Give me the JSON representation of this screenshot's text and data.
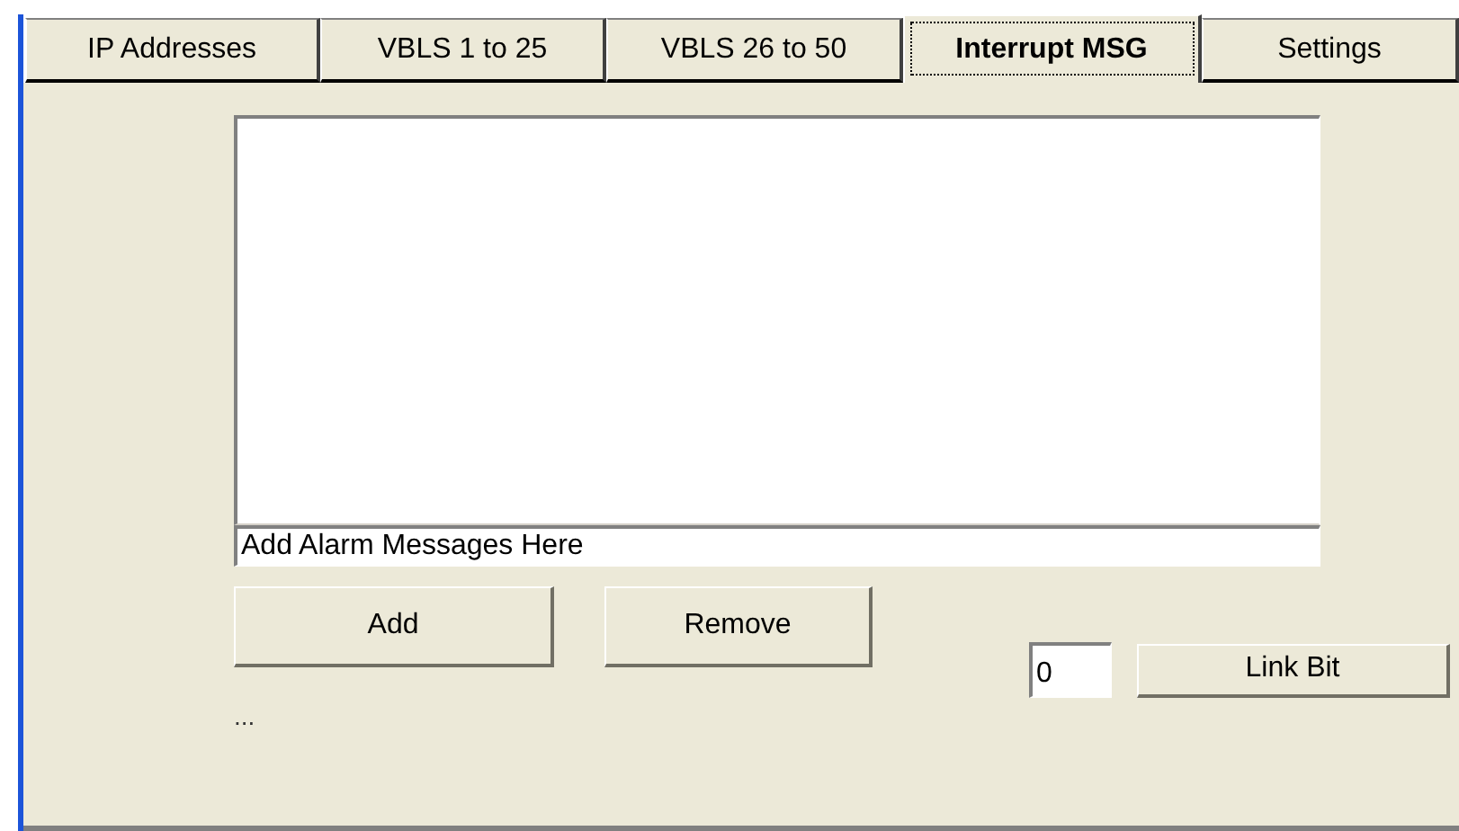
{
  "tabs": [
    {
      "label": "IP Addresses",
      "selected": false
    },
    {
      "label": "VBLS 1 to 25",
      "selected": false
    },
    {
      "label": "VBLS 26 to 50",
      "selected": false
    },
    {
      "label": "Interrupt MSG",
      "selected": true
    },
    {
      "label": "Settings",
      "selected": false
    }
  ],
  "message_field": {
    "value": "Add Alarm Messages Here"
  },
  "buttons": {
    "add": "Add",
    "remove": "Remove"
  },
  "link_bit": {
    "value": "0",
    "button": "Link Bit"
  },
  "status_text": "..."
}
